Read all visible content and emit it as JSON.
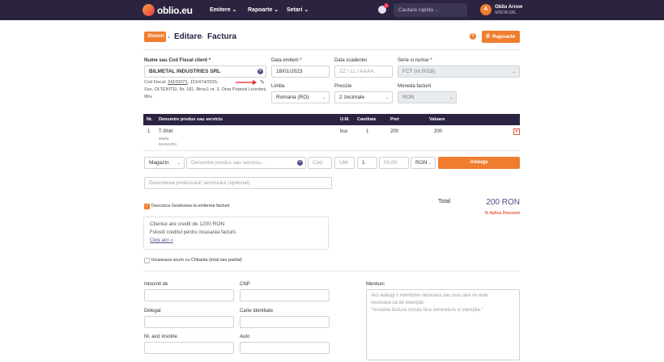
{
  "header": {
    "brand": "oblio.eu",
    "nav": [
      {
        "label": "Emitere"
      },
      {
        "label": "Rapoarte"
      },
      {
        "label": "Setari"
      }
    ],
    "notifications_count": "1",
    "search_placeholder": "Cautare rapida ...",
    "user": {
      "initial": "A",
      "name": "Oblio Arrow",
      "company": "SPETA SRL"
    }
  },
  "breadcrumb": {
    "tag": "Stocuri",
    "items": [
      "Editare",
      "Factura"
    ]
  },
  "actions": {
    "help": "?",
    "reports_label": "Rapoarte"
  },
  "client": {
    "label": "Nume sau Cod Fiscal client *",
    "value": "BILMETAL INDUSTRIES SRL",
    "cif_prefix": "Cod Fiscal: ",
    "cif": "34100071",
    "details_line1": ", J23/474/2015,",
    "details_line2": "Sos. OLTENITEI, Nr. 181, Birou1 nr. 3, Oras Popesti Leordeni,",
    "details_line3": "Ilfov"
  },
  "issue_date": {
    "label": "Data emiterii *",
    "value": "18/01/2023"
  },
  "due_date": {
    "label": "Data scadentei",
    "placeholder": "ZZ / LL / AAAA"
  },
  "series": {
    "label": "Serie si numar *",
    "value": "FCT (nr.0018)"
  },
  "language": {
    "label": "Limba",
    "value": "Romana (RO)"
  },
  "precision": {
    "label": "Precizie",
    "value": "2 zecimale"
  },
  "currency": {
    "label": "Moneda facturii",
    "value": "RON"
  },
  "table": {
    "headers": {
      "nr": "Nr.",
      "product": "Denumire produs sau serviciu",
      "um": "U.M.",
      "qty": "Cantitate",
      "price": "Pret",
      "value": "Valoare"
    },
    "rows": [
      {
        "nr": "1",
        "product": "T-Shirt",
        "sub1": "Marfa",
        "sub2": "MAGAZIN",
        "um": "buc",
        "qty": "1",
        "price": "200",
        "value": "200"
      }
    ]
  },
  "add_line": {
    "warehouse": "Magazin",
    "product_placeholder": "Denumire produs sau serviciu...",
    "code_placeholder": "Cod",
    "um_placeholder": "UM",
    "qty": "1",
    "price_placeholder": "00,00",
    "currency": "RON",
    "add_label": "Adauga",
    "description_placeholder": "Descrierea produsului/ serviciului (optional)"
  },
  "totals": {
    "label": "Total:",
    "value": "200 RON",
    "discount_link": "% Aplica Discount"
  },
  "stock_check": {
    "label": "Descarca Gestiunea la emiterea facturii",
    "checked": true
  },
  "credit_box": {
    "line1": "Clientul are credit de 1200 RON",
    "line2": "Folositi creditul pentru incasarea facturii.",
    "link": "Click aici »"
  },
  "receipt_check": {
    "label": "Incaseaza acum cu Chitanta (total sau partial)",
    "checked": false
  },
  "delegate": {
    "issued_by_label": "Intocmit de",
    "cnp_label": "CNP",
    "delegate_label": "Delegat",
    "id_card_label": "Carte Identitate",
    "notice_label": "Nr. aviz insotire",
    "auto_label": "Auto"
  },
  "mentions": {
    "label": "Mentiuni",
    "placeholder_line1": "Aici adaugi o mentiune necesara sau una care nu este",
    "placeholder_line2": "necesara ca de exemplu:",
    "placeholder_line3": "\"Aceasta factura circula fara semnatura si stampila.\""
  },
  "colors": {
    "brand_dark": "#2b2340",
    "accent_orange": "#f07d2e",
    "total_purple": "#5b4a8a",
    "discount_red": "#e4573d"
  }
}
